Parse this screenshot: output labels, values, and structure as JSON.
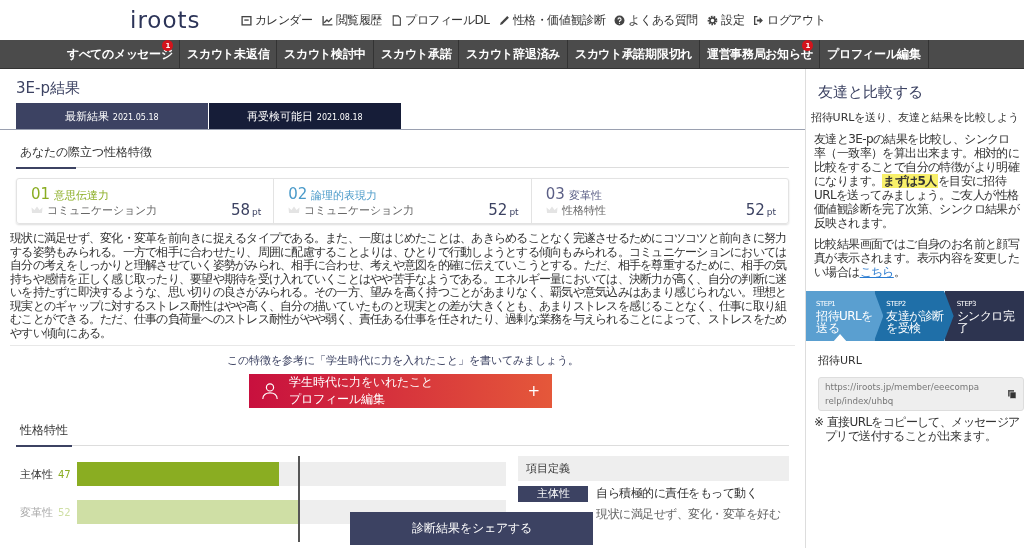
{
  "header": {
    "logo": "iroots",
    "links": [
      {
        "label": "カレンダー"
      },
      {
        "label": "閲覧履歴"
      },
      {
        "label": "プロフィールDL"
      },
      {
        "label": "性格・価値観診断"
      },
      {
        "label": "よくある質問"
      },
      {
        "label": "設定"
      },
      {
        "label": "ログアウト"
      }
    ]
  },
  "nav": [
    {
      "label": "すべてのメッセージ",
      "badge": "1"
    },
    {
      "label": "スカウト未返信"
    },
    {
      "label": "スカウト検討中"
    },
    {
      "label": "スカウト承諾"
    },
    {
      "label": "スカウト辞退済み"
    },
    {
      "label": "スカウト承諾期限切れ"
    },
    {
      "label": "運営事務局お知らせ",
      "badge": "1"
    },
    {
      "label": "プロフィール編集"
    }
  ],
  "page_title": "3E-p結果",
  "tabs": [
    {
      "label": "最新結果",
      "date": "2021.05.18",
      "selected": true
    },
    {
      "label": "再受検可能日",
      "date": "2021.08.18",
      "selected": false
    }
  ],
  "features": {
    "heading": "あなたの際立つ性格特徴",
    "cards": [
      {
        "number": "01",
        "name": "意思伝達力",
        "category": "コミュニケーション力",
        "score": "58",
        "unit": "pt",
        "color": "#8aad22"
      },
      {
        "number": "02",
        "name": "論理的表現力",
        "category": "コミュニケーション力",
        "score": "52",
        "unit": "pt",
        "color": "#4a9ac9"
      },
      {
        "number": "03",
        "name": "変革性",
        "category": "性格特性",
        "score": "52",
        "unit": "pt",
        "color": "#5b5f86"
      }
    ],
    "description": "現状に満足せず、変化・変革を前向きに捉えるタイプである。また、一度はじめたことは、あきらめることなく完遂させるためにコツコツと前向きに努力する姿勢もみられる。一方で相手に合わせたり、周囲に配慮することよりは、ひとりで行動しようとする傾向もみられる。コミュニケーションにおいては自分の考えをしっかりと理解させていく姿勢がみられ、相手に合わせ、考えや意図を的確に伝えていこうとする。ただ、相手を尊重するために、相手の気持ちや感情を正しく感じ取ったり、要望や期待を受け入れていくことはやや苦手なようである。エネルギー量においては、決断力が高く、自分の判断に迷いを持たずに即決するような、思い切りの良さがみられる。その一方、望みを高く持つことがあまりなく、覇気や意気込みはあまり感じられない。理想と現実とのギャップに対するストレス耐性はやや高く、自分の描いていたものと現実との差が大きくとも、あまりストレスを感じることなく、仕事に取り組むことができる。ただ、仕事の負荷量へのストレス耐性がやや弱く、責任ある仕事を任されたり、過剰な業務を与えられることによって、ストレスをためやすい傾向にある。",
    "prompt": "この特徴を参考に「学生時代に力を入れたこと」を書いてみましょう。",
    "cta": {
      "title": "学生時代に力をいれたこと",
      "subtitle": "プロフィール編集",
      "plus": "+"
    }
  },
  "traits": {
    "heading": "性格特性",
    "rows": [
      {
        "name": "主体性",
        "score": "47",
        "level": 0.47,
        "color": "#8aad22",
        "faded": false
      },
      {
        "name": "変革性",
        "score": "52",
        "level": 0.52,
        "color": "#cfdfa5",
        "faded": true
      }
    ],
    "definitions": {
      "heading": "項目定義",
      "rows": [
        {
          "tag": "主体性",
          "text": "自ら積極的に責任をもって動く"
        },
        {
          "text": "現状に満足せず、変化・変革を好む"
        }
      ]
    }
  },
  "share_button": "診断結果をシェアする",
  "sidebar": {
    "title": "友達と比較する",
    "subtitle": "招待URLを送り、友達と結果を比較しよう",
    "intro": {
      "before": "友達と3E-pの結果を比較し、シンクロ率（一致率）を算出出来ます。相対的に比較をすることで自分の特徴がより明確になります。",
      "highlight": "まずは5人",
      "after": "を目安に招待URLを送ってみましょう。ご友人が性格価値観診断を完了次第、シンクロ結果が反映されます。"
    },
    "note": {
      "text": "比較結果画面ではご自身のお名前と顔写真が表示されます。表示内容を変更したい場合は",
      "link": "こちら",
      "end": "。"
    },
    "steps": [
      {
        "step": "STEP1",
        "label": "招待URLを送る",
        "color": "#5a9fd0",
        "selected": true
      },
      {
        "step": "STEP2",
        "label": "友達が診断を受検",
        "color": "#1f6fa8",
        "selected": false
      },
      {
        "step": "STEP3",
        "label": "シンクロ完了",
        "color": "#2d3450",
        "selected": false
      }
    ],
    "url_label": "招待URL",
    "url": "https://iroots.jp/member/eeecompa relp/index/uhbq",
    "url_note": "※ 直接URLをコピーして、メッセージアプリで送付することが出来ます。"
  }
}
